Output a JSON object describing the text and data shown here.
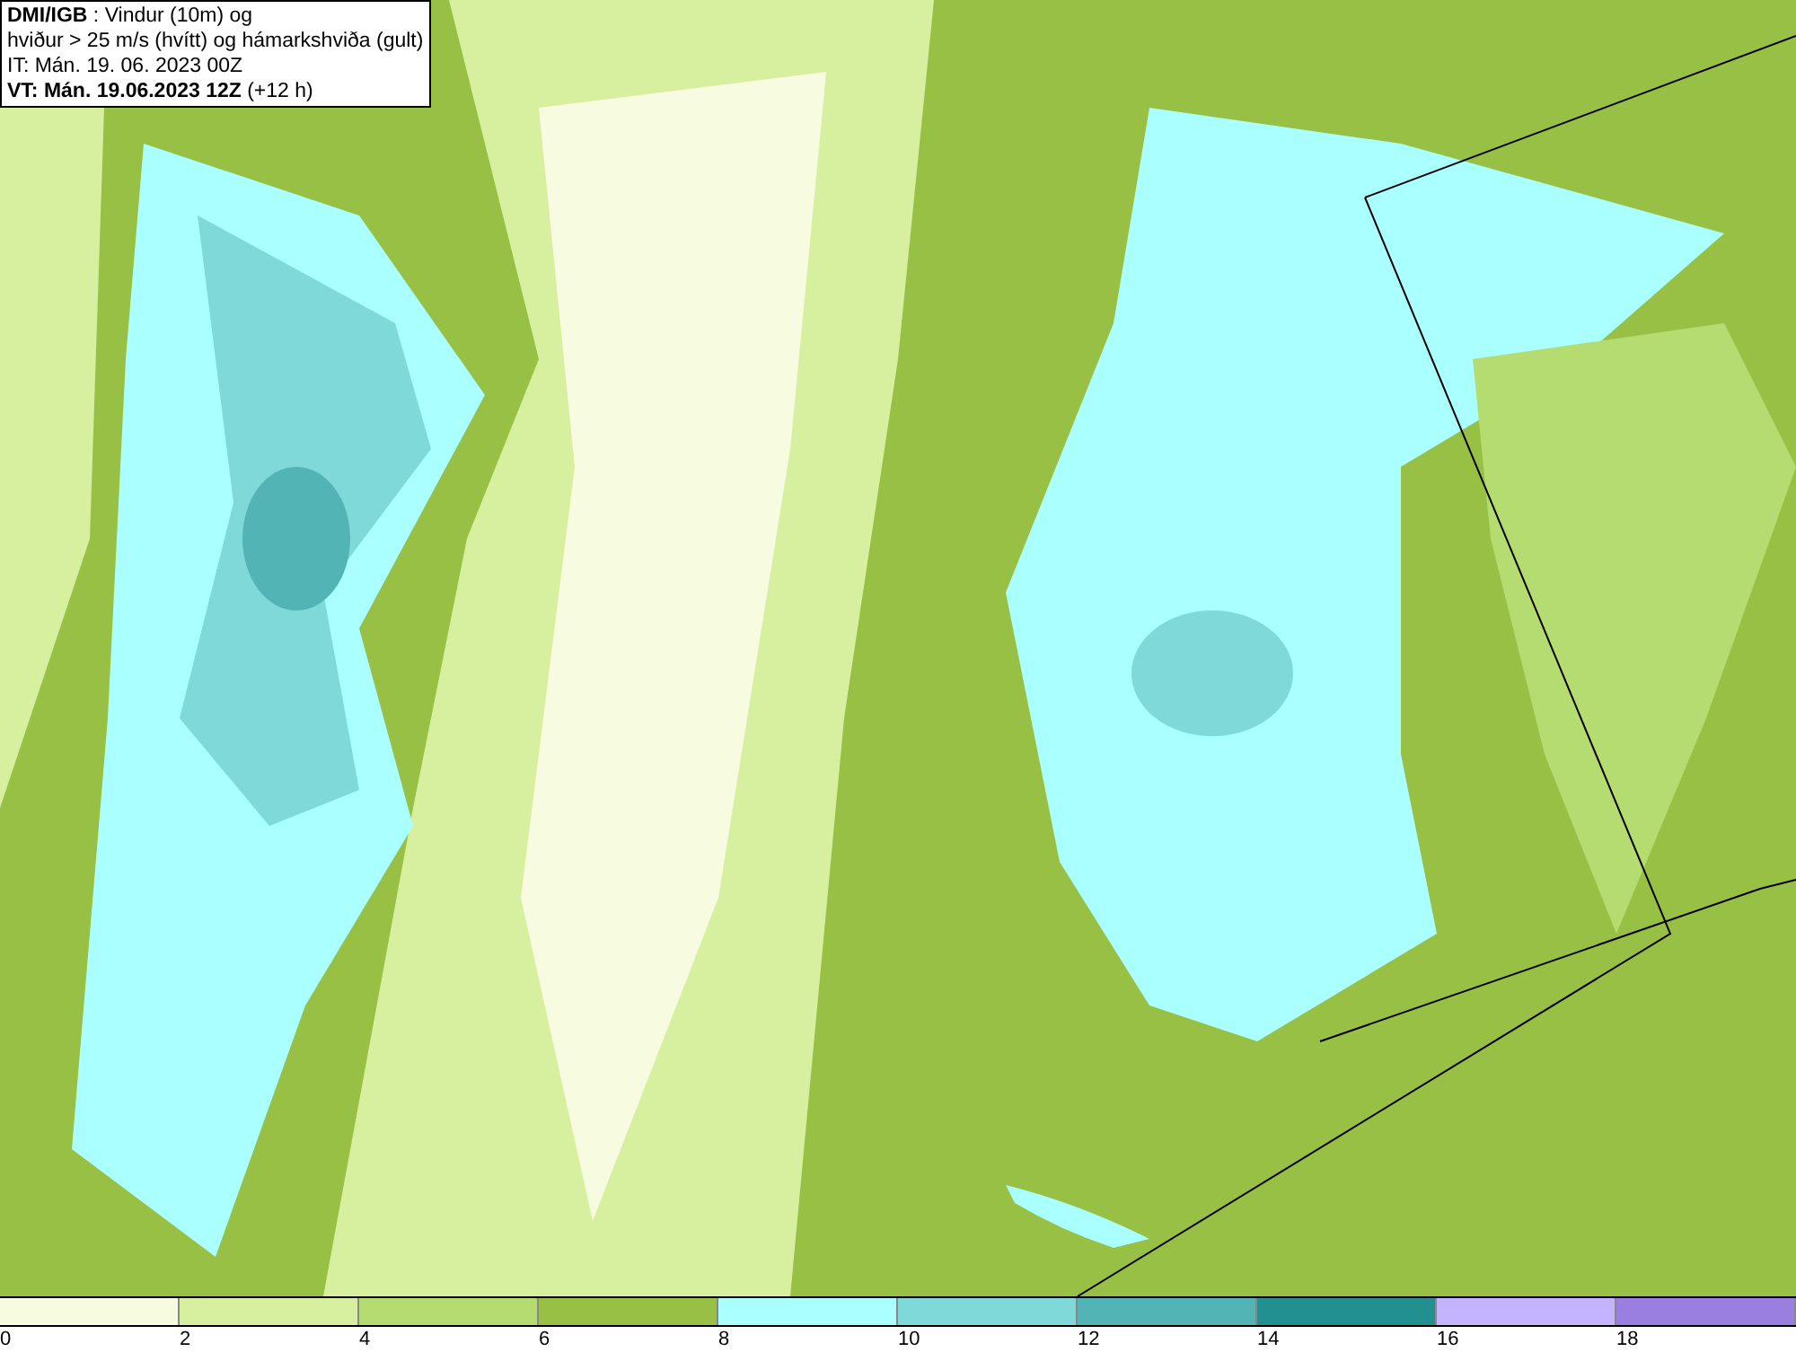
{
  "title_box": {
    "lines": [
      "**DMI/IGB** : Vindur (10m) og",
      "hviður > 25 m/s (hvítt) og hámarkshviða (gult)",
      "IT: Mán. 19. 06. 2023 00Z",
      "**VT: Mán. 19.06.2023 12Z** (+12 h)"
    ]
  },
  "legend": [
    {
      "label": "0",
      "color": "#f7fce0"
    },
    {
      "label": "2",
      "color": "#d7f0a0"
    },
    {
      "label": "4",
      "color": "#b5dc70"
    },
    {
      "label": "6",
      "color": "#98c044"
    },
    {
      "label": "8",
      "color": "#aaffff"
    },
    {
      "label": "10",
      "color": "#7fd9d9"
    },
    {
      "label": "12",
      "color": "#52b4b4"
    },
    {
      "label": "14",
      "color": "#229090"
    },
    {
      "label": "16",
      "color": "#c4b4ff"
    },
    {
      "label": "18",
      "color": "#9a7fe0"
    }
  ]
}
